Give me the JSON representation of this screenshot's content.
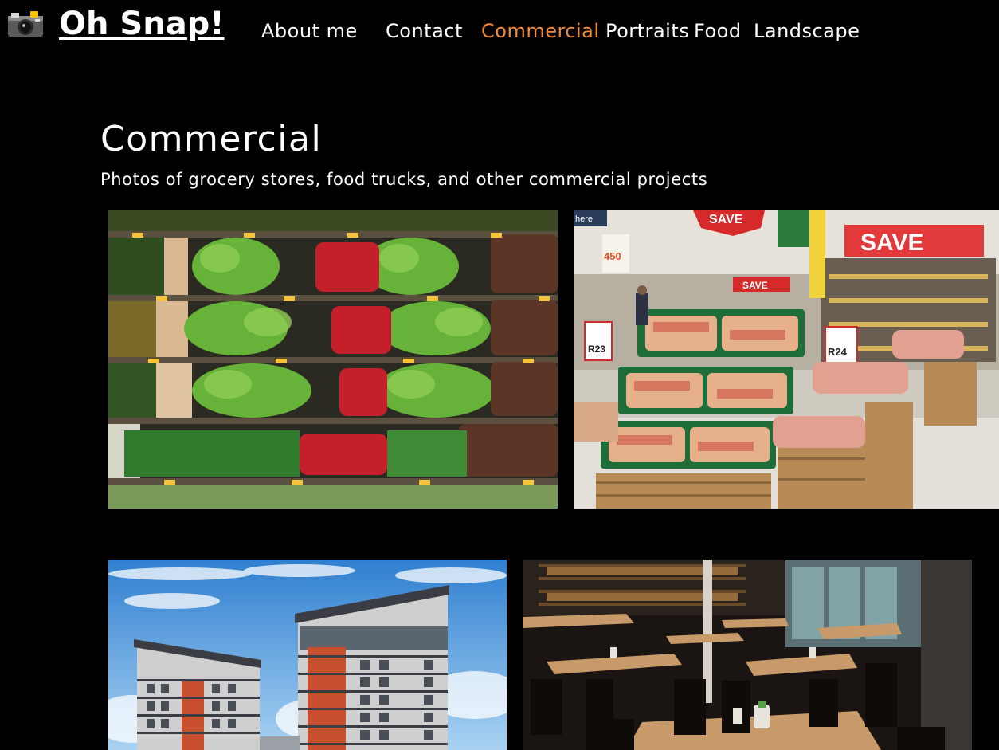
{
  "header": {
    "logo_text": "Oh Snap!",
    "logo_icon": "camera-icon",
    "nav": [
      {
        "label": "About me",
        "active": false
      },
      {
        "label": "Contact",
        "active": false
      },
      {
        "label": "Commercial",
        "active": true
      },
      {
        "label": "Portraits",
        "active": false
      },
      {
        "label": "Food",
        "active": false
      },
      {
        "label": "Landscape",
        "active": false
      }
    ],
    "active_color": "#ef8a3c"
  },
  "main": {
    "title": "Commercial",
    "subtitle": "Photos of grocery stores, food trucks, and other commercial projects"
  },
  "photos": {
    "p2_signs": {
      "save_top": "SAVE",
      "save_banner": "SAVE",
      "price_left": "R23",
      "price_right": "R24",
      "price_tag": "SAVE",
      "small_tag": "450",
      "here": "here"
    }
  }
}
